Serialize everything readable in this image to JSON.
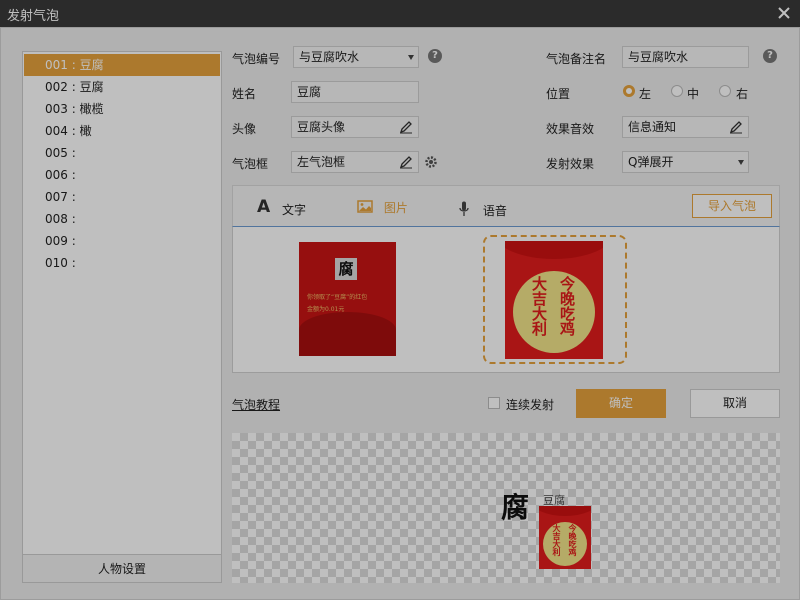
{
  "window": {
    "title": "发射气泡"
  },
  "list": {
    "items": [
      "001 : 豆腐",
      "002 : 豆腐",
      "003 : 橄榄",
      "004 : 橄",
      "005 :",
      "006 :",
      "007 :",
      "008 :",
      "009 :",
      "010 :"
    ],
    "selected_index": 0,
    "role_button": "人物设置"
  },
  "form": {
    "bubble_id_label": "气泡编号",
    "bubble_id_value": "与豆腐吹水",
    "name_label": "姓名",
    "name_value": "豆腐",
    "avatar_label": "头像",
    "avatar_value": "豆腐头像",
    "frame_label": "气泡框",
    "frame_value": "左气泡框",
    "note_label": "气泡备注名",
    "note_value": "与豆腐吹水",
    "position_label": "位置",
    "position_left": "左",
    "position_center": "中",
    "position_right": "右",
    "sound_label": "效果音效",
    "sound_value": "信息通知",
    "effect_label": "发射效果",
    "effect_value": "Q弹展开",
    "help": "?"
  },
  "tabs": {
    "text": "文字",
    "image": "图片",
    "voice": "语音",
    "import": "导入气泡",
    "active": "image"
  },
  "card1": {
    "char": "腐",
    "line1": "你领取了“豆腐”的红包",
    "line2": "金额为0.01元"
  },
  "card2": {
    "right_col": "今晚吃鸡",
    "left_col": "大吉大利"
  },
  "bottom": {
    "tutorial": "气泡教程",
    "continuous": "连续发射",
    "ok": "确定",
    "cancel": "取消"
  },
  "preview": {
    "avatar_char": "腐",
    "name": "豆腐",
    "right_col": "今晚吃鸡",
    "left_col": "大吉大利"
  },
  "colors": {
    "accent": "#e6a23c",
    "envelope_red": "#e21d1d",
    "envelope_yellow": "#f2e48a"
  }
}
